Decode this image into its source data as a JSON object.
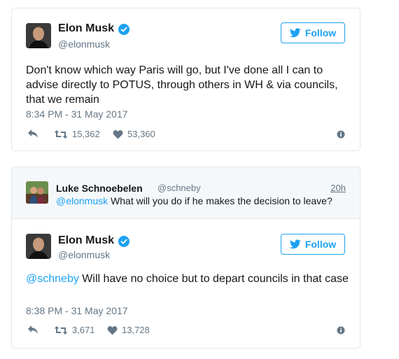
{
  "tweet1": {
    "author_name": "Elon Musk",
    "author_handle": "@elonmusk",
    "follow_label": "Follow",
    "text": "Don't know which way Paris will go, but I've done all I can to advise directly to POTUS, through others in WH & via councils, that we remain",
    "timestamp": "8:34 PM - 31 May 2017",
    "retweets": "15,362",
    "likes": "53,360"
  },
  "reply_context": {
    "author_name": "Luke Schnoebelen",
    "author_handle": "@schneby",
    "time": "20h",
    "mention": "@elonmusk",
    "text": " What will you do if he makes the decision to leave?"
  },
  "tweet2": {
    "author_name": "Elon Musk",
    "author_handle": "@elonmusk",
    "follow_label": "Follow",
    "mention": "@schneby",
    "text": " Will have no choice but to depart councils in that case",
    "timestamp": "8:38 PM - 31 May 2017",
    "retweets": "3,671",
    "likes": "13,728"
  },
  "colors": {
    "brand_blue": "#1da1f2",
    "text_primary": "#14171a",
    "text_secondary": "#657786",
    "border": "#e1e8ed"
  },
  "icons": {
    "verified": "verified-badge-icon",
    "bird": "twitter-bird-icon",
    "reply": "reply-icon",
    "retweet": "retweet-icon",
    "like": "heart-icon",
    "info": "info-icon"
  }
}
